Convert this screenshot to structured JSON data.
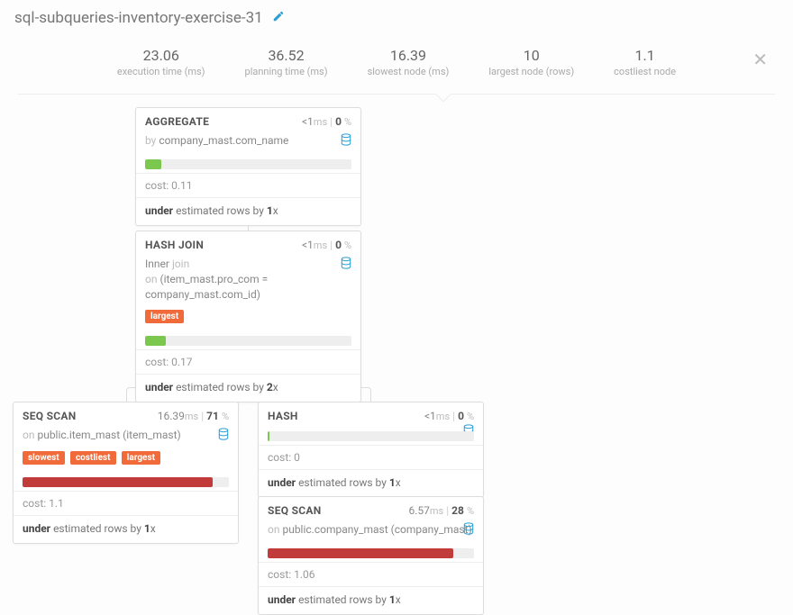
{
  "title": "sql-subqueries-inventory-exercise-31",
  "stats": {
    "exec": {
      "value": "23.06",
      "label": "execution time (ms)"
    },
    "plan": {
      "value": "36.52",
      "label": "planning time (ms)"
    },
    "slow": {
      "value": "16.39",
      "label": "slowest node (ms)"
    },
    "largest": {
      "value": "10",
      "label": "largest node (rows)"
    },
    "cost": {
      "value": "1.1",
      "label": "costliest node"
    }
  },
  "nodes": {
    "aggregate": {
      "name": "AGGREGATE",
      "time_val": "<1",
      "time_unit": "ms",
      "pct": "0",
      "detail_prefix": "by",
      "detail": "company_mast.com_name",
      "bar_pct": 8,
      "bar_class": "bar-green",
      "cost_label": "cost:",
      "cost": "0.11",
      "under_a": "under",
      "under_b": "estimated rows by",
      "under_x": "1",
      "under_suf": "x"
    },
    "hashjoin": {
      "name": "HASH JOIN",
      "time_val": "<1",
      "time_unit": "ms",
      "pct": "0",
      "line1a": "Inner",
      "line1b": "join",
      "line2a": "on",
      "line2b": "(item_mast.pro_com = company_mast.com_id)",
      "tag1": "largest",
      "bar_pct": 10,
      "bar_class": "bar-green",
      "cost_label": "cost:",
      "cost": "0.17",
      "under_a": "under",
      "under_b": "estimated rows by",
      "under_x": "2",
      "under_suf": "x"
    },
    "seqscan1": {
      "name": "SEQ SCAN",
      "time_val": "16.39",
      "time_unit": "ms",
      "pct": "71",
      "line1a": "on",
      "line1b": "public.item_mast (item_mast)",
      "tag1": "slowest",
      "tag2": "costliest",
      "tag3": "largest",
      "bar_pct": 92,
      "bar_class": "bar-red",
      "cost_label": "cost:",
      "cost": "1.1",
      "under_a": "under",
      "under_b": "estimated rows by",
      "under_x": "1",
      "under_suf": "x"
    },
    "hash": {
      "name": "HASH",
      "time_val": "<1",
      "time_unit": "ms",
      "pct": "0",
      "bar_pct": 1,
      "bar_class": "bar-green",
      "cost_label": "cost:",
      "cost": "0",
      "under_a": "under",
      "under_b": "estimated rows by",
      "under_x": "1",
      "under_suf": "x"
    },
    "seqscan2": {
      "name": "SEQ SCAN",
      "time_val": "6.57",
      "time_unit": "ms",
      "pct": "28",
      "line1a": "on",
      "line1b": "public.company_mast (company_mast)",
      "bar_pct": 90,
      "bar_class": "bar-red",
      "cost_label": "cost:",
      "cost": "1.06",
      "under_a": "under",
      "under_b": "estimated rows by",
      "under_x": "1",
      "under_suf": "x"
    }
  },
  "pct_sign": "%"
}
